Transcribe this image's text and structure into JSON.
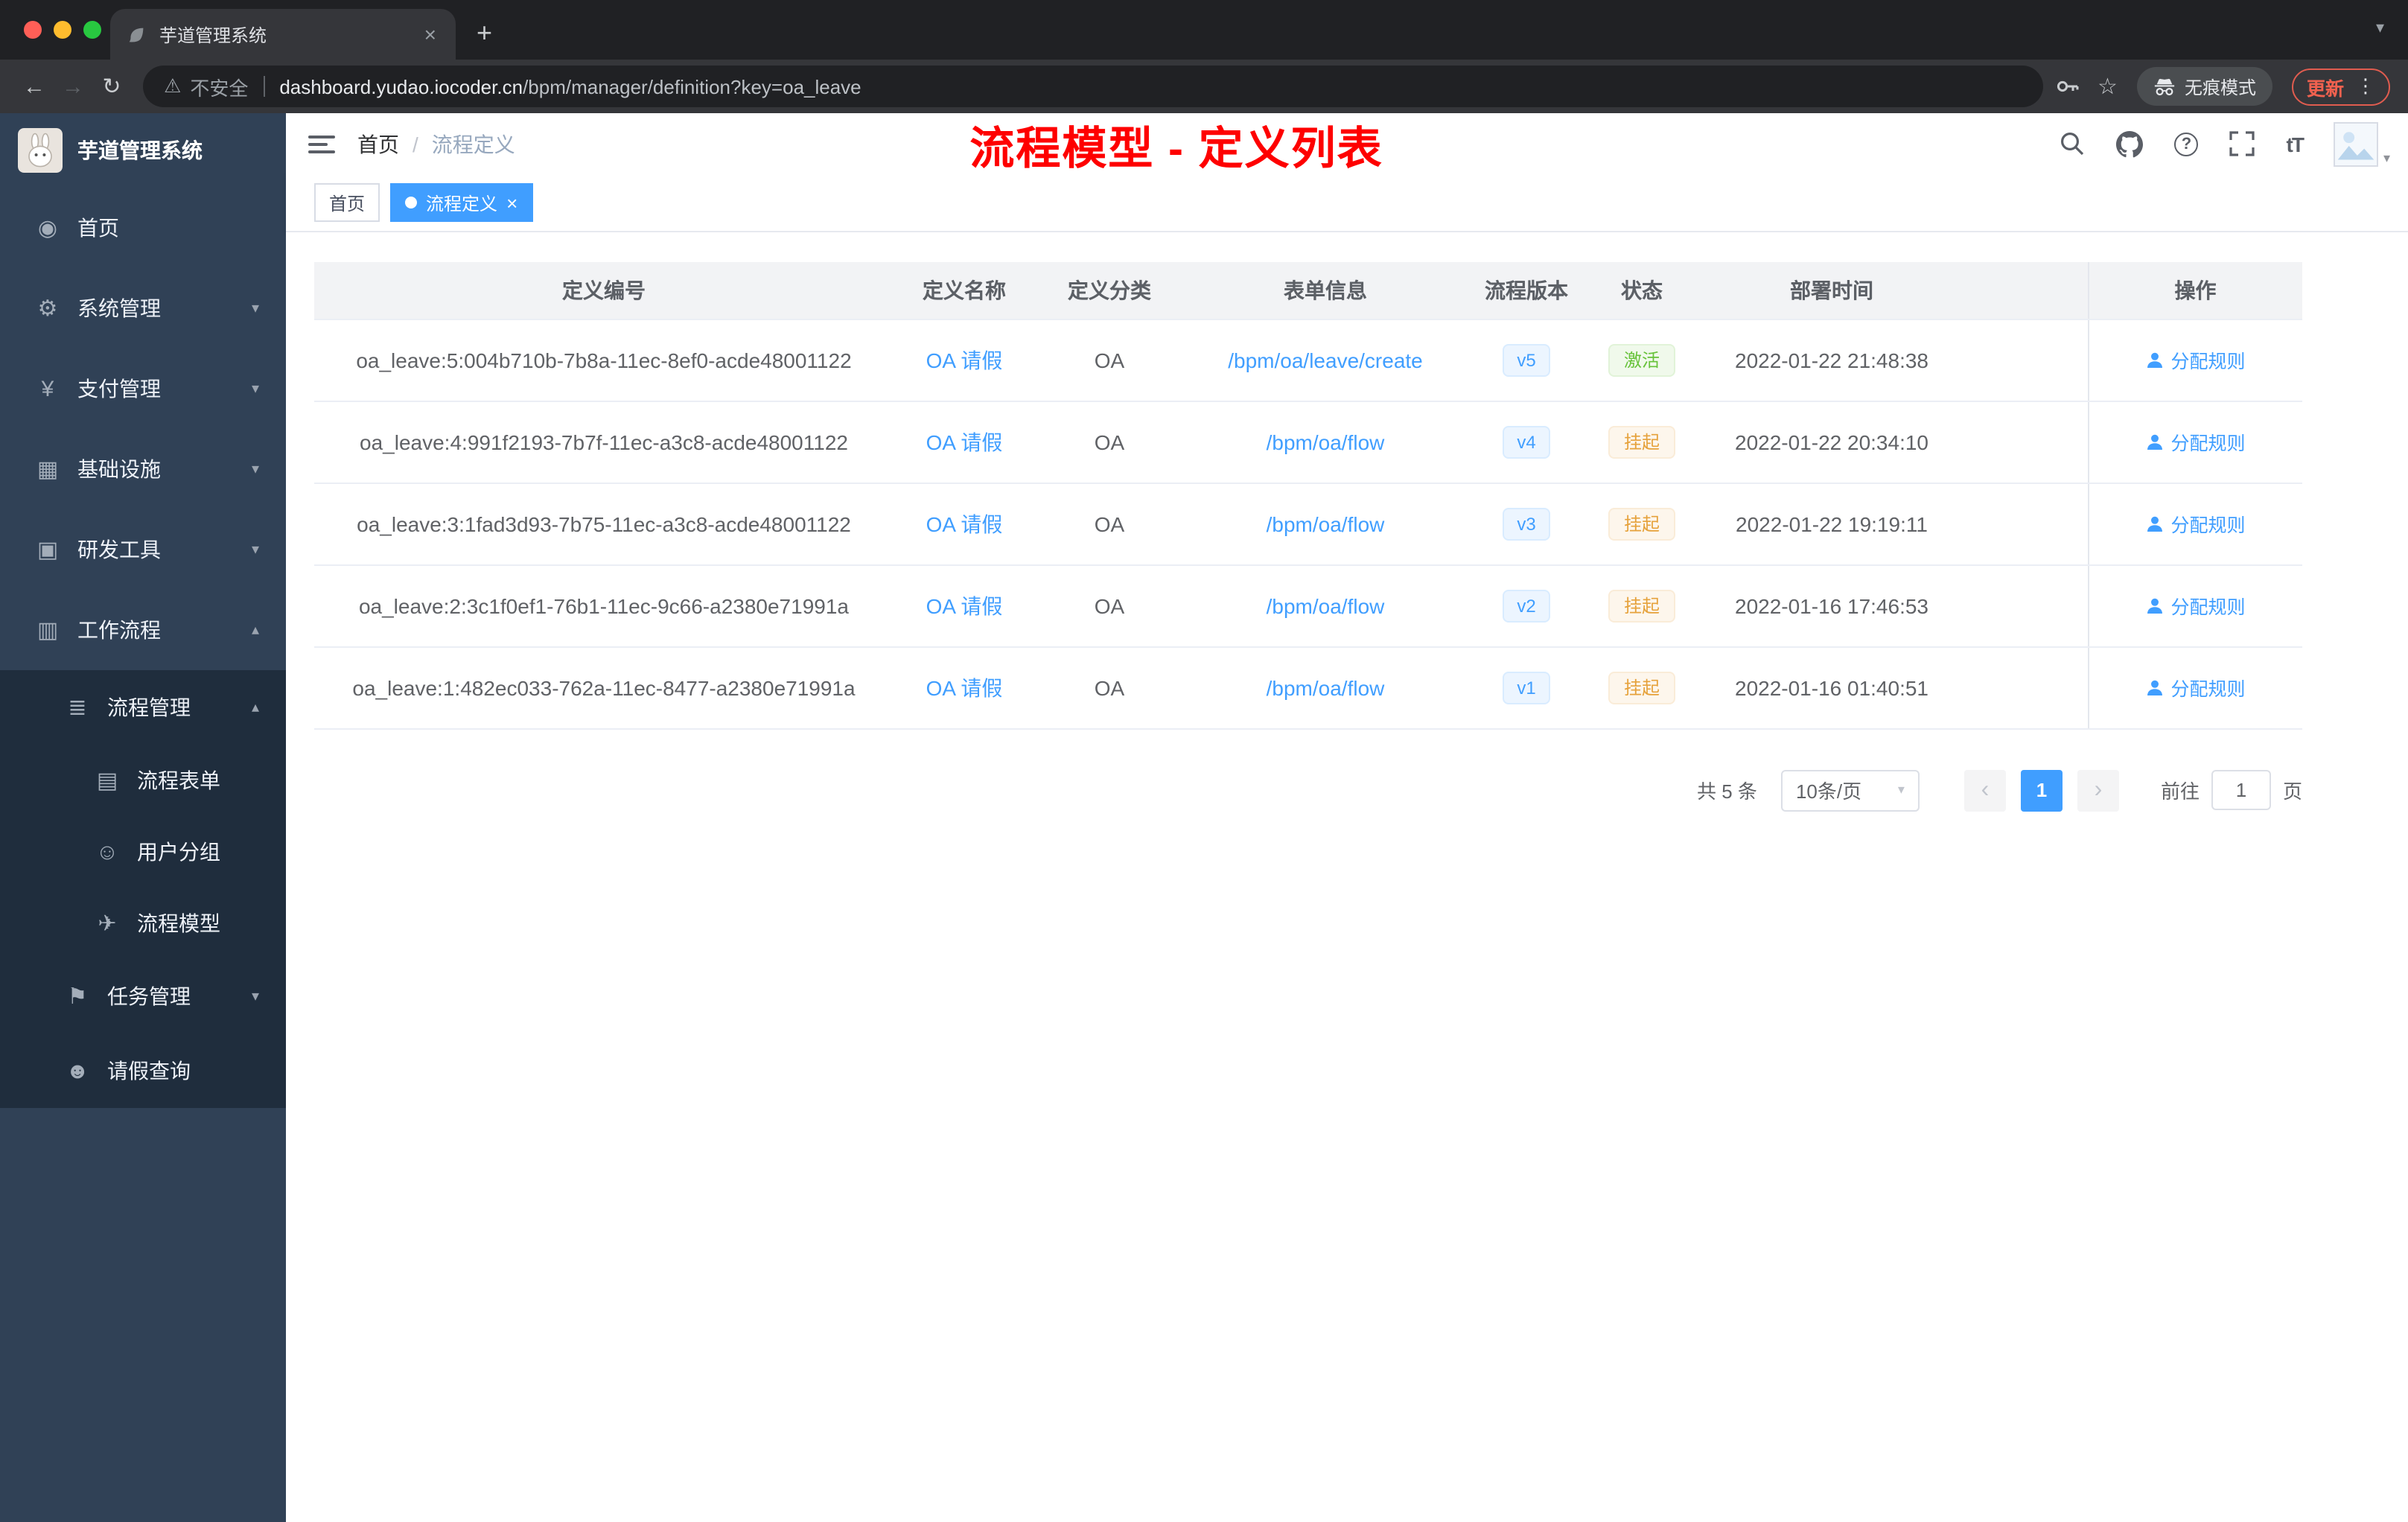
{
  "browser": {
    "tab_title": "芋道管理系统",
    "security_label": "不安全",
    "url_host": "dashboard.yudao.iocoder.cn",
    "url_path": "/bpm/manager/definition?key=oa_leave",
    "incognito_label": "无痕模式",
    "update_label": "更新"
  },
  "sidebar": {
    "logo_title": "芋道管理系统",
    "items": [
      {
        "label": "首页"
      },
      {
        "label": "系统管理"
      },
      {
        "label": "支付管理"
      },
      {
        "label": "基础设施"
      },
      {
        "label": "研发工具"
      },
      {
        "label": "工作流程"
      },
      {
        "label": "流程管理"
      },
      {
        "label": "流程表单"
      },
      {
        "label": "用户分组"
      },
      {
        "label": "流程模型"
      },
      {
        "label": "任务管理"
      },
      {
        "label": "请假查询"
      }
    ]
  },
  "navbar": {
    "breadcrumb_home": "首页",
    "breadcrumb_sep": "/",
    "breadcrumb_current": "流程定义",
    "annotation": "流程模型 - 定义列表"
  },
  "tags": {
    "home": "首页",
    "active": "流程定义"
  },
  "table": {
    "columns": [
      "定义编号",
      "定义名称",
      "定义分类",
      "表单信息",
      "流程版本",
      "状态",
      "部署时间",
      "操作"
    ],
    "rows": [
      {
        "id": "oa_leave:5:004b710b-7b8a-11ec-8ef0-acde48001122",
        "name": "OA 请假",
        "category": "OA",
        "form": "/bpm/oa/leave/create",
        "version": "v5",
        "status": "激活",
        "time": "2022-01-22 21:48:38",
        "action": "分配规则"
      },
      {
        "id": "oa_leave:4:991f2193-7b7f-11ec-a3c8-acde48001122",
        "name": "OA 请假",
        "category": "OA",
        "form": "/bpm/oa/flow",
        "version": "v4",
        "status": "挂起",
        "time": "2022-01-22 20:34:10",
        "action": "分配规则"
      },
      {
        "id": "oa_leave:3:1fad3d93-7b75-11ec-a3c8-acde48001122",
        "name": "OA 请假",
        "category": "OA",
        "form": "/bpm/oa/flow",
        "version": "v3",
        "status": "挂起",
        "time": "2022-01-22 19:19:11",
        "action": "分配规则"
      },
      {
        "id": "oa_leave:2:3c1f0ef1-76b1-11ec-9c66-a2380e71991a",
        "name": "OA 请假",
        "category": "OA",
        "form": "/bpm/oa/flow",
        "version": "v2",
        "status": "挂起",
        "time": "2022-01-16 17:46:53",
        "action": "分配规则"
      },
      {
        "id": "oa_leave:1:482ec033-762a-11ec-8477-a2380e71991a",
        "name": "OA 请假",
        "category": "OA",
        "form": "/bpm/oa/flow",
        "version": "v1",
        "status": "挂起",
        "time": "2022-01-16 01:40:51",
        "action": "分配规则"
      }
    ]
  },
  "pagination": {
    "total": "共 5 条",
    "page_size": "10条/页",
    "page": "1",
    "goto_prefix": "前往",
    "goto_value": "1",
    "goto_suffix": "页"
  },
  "icons": {
    "back": "←",
    "forward": "→",
    "reload": "↻",
    "warning": "⚠",
    "star": "☆",
    "dots": "⋮",
    "chevron_down": "▾",
    "chevron_up": "▴",
    "close": "×",
    "plus": "+",
    "question": "?",
    "fontsize": "tT",
    "prev": "‹",
    "next": "›",
    "dashboard": "◉",
    "gear": "⚙",
    "yen": "¥",
    "infra": "▦",
    "tools": "▣",
    "workflow": "▥",
    "process": "≣",
    "form": "▤",
    "users": "☺",
    "model": "✈",
    "task": "⚑",
    "person": "☻"
  }
}
